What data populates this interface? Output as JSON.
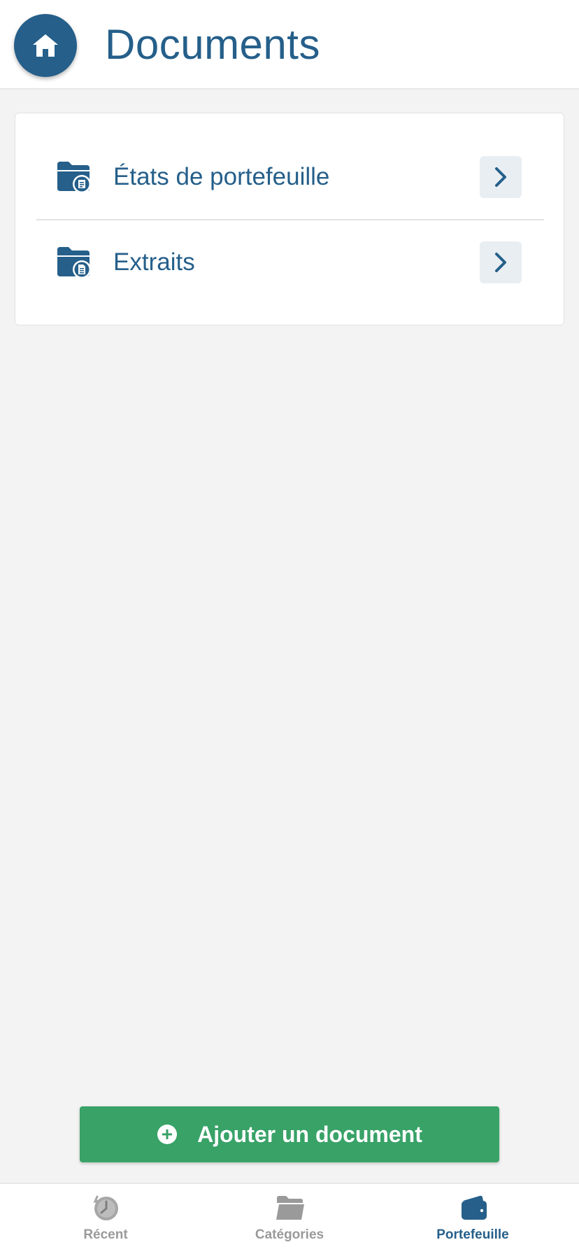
{
  "header": {
    "title": "Documents",
    "home_icon": "home-icon"
  },
  "colors": {
    "brand": "#255f8a",
    "action": "#38a267",
    "inactive": "#9a9a9a",
    "background": "#f3f3f3"
  },
  "list": {
    "items": [
      {
        "label": "États de portefeuille",
        "icon": "folder-statement-icon",
        "action_icon": "chevron-right-icon"
      },
      {
        "label": "Extraits",
        "icon": "folder-extract-icon",
        "action_icon": "chevron-right-icon"
      }
    ]
  },
  "actions": {
    "add_label": "Ajouter un document",
    "add_icon": "plus-circle-icon"
  },
  "bottom_nav": {
    "items": [
      {
        "label": "Récent",
        "icon": "clock-icon",
        "active": false
      },
      {
        "label": "Catégories",
        "icon": "folder-icon",
        "active": false
      },
      {
        "label": "Portefeuille",
        "icon": "wallet-icon",
        "active": true
      }
    ]
  }
}
